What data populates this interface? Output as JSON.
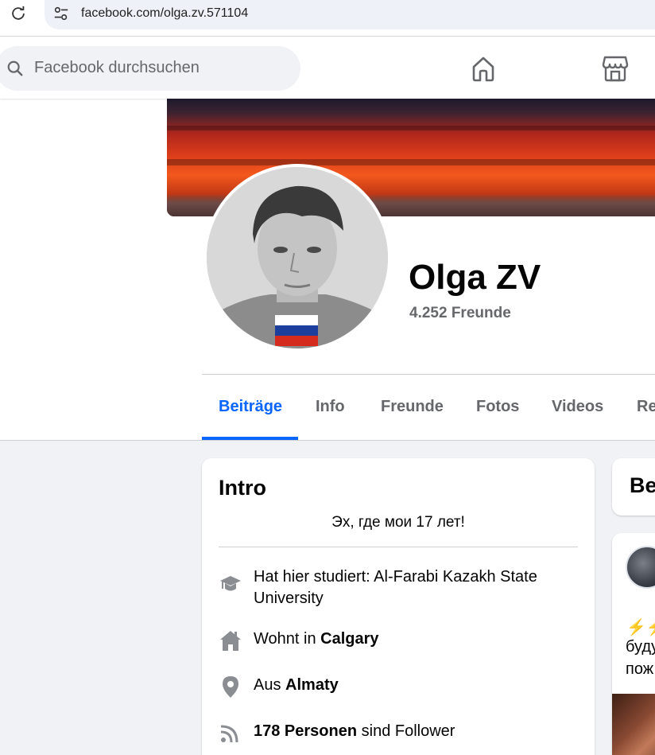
{
  "browser": {
    "url": "facebook.com/olga.zv.571104"
  },
  "nav": {
    "search_placeholder": "Facebook durchsuchen"
  },
  "profile": {
    "name": "Olga ZV",
    "friends_count": "4.252 Freunde"
  },
  "tabs": [
    {
      "label": "Beiträge",
      "active": true
    },
    {
      "label": "Info",
      "active": false
    },
    {
      "label": "Freunde",
      "active": false
    },
    {
      "label": "Fotos",
      "active": false
    },
    {
      "label": "Videos",
      "active": false
    },
    {
      "label": "Re",
      "active": false
    }
  ],
  "intro": {
    "title": "Intro",
    "bio": "Эх, где мои 17 лет!",
    "items": [
      {
        "icon": "education-cap-icon",
        "prefix": "Hat hier studiert: Al-Farabi Kazakh State University",
        "bold": ""
      },
      {
        "icon": "home-icon",
        "prefix": "Wohnt in ",
        "bold": "Calgary"
      },
      {
        "icon": "location-pin-icon",
        "prefix": "Aus ",
        "bold": "Almaty"
      },
      {
        "icon": "followers-feed-icon",
        "bold_first": "178 Personen",
        "suffix": " sind Follower"
      }
    ]
  },
  "right_column": {
    "card_title": "Be",
    "post_emoji": "⚡⚡",
    "post_line1": "буду",
    "post_line2": "пож"
  },
  "colors": {
    "accent": "#0866ff",
    "secondary_text": "#65676b",
    "page_bg": "#f0f2f5"
  }
}
